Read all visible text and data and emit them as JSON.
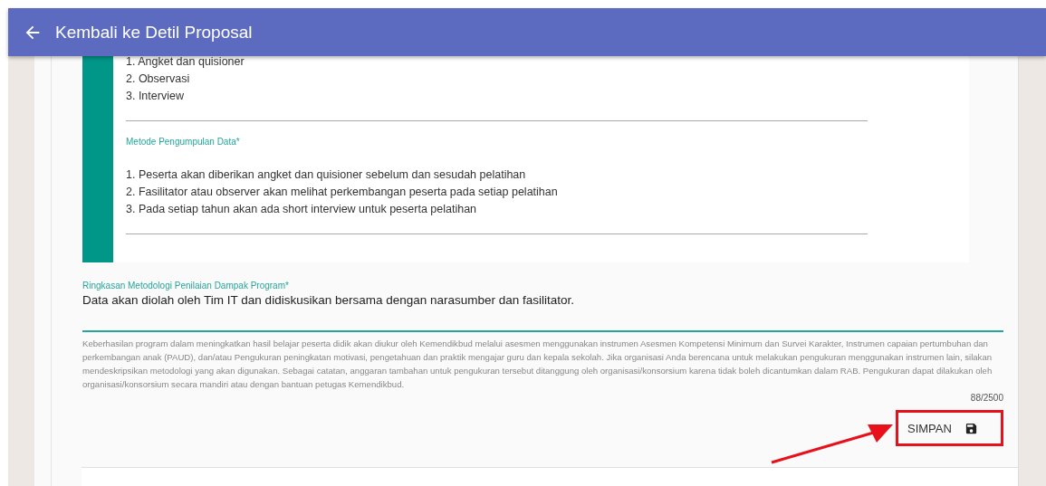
{
  "header": {
    "title": "Kembali ke Detil Proposal"
  },
  "previous_field": {
    "items": [
      "1. Angket dan quisioner",
      "2. Observasi",
      "3. Interview"
    ]
  },
  "data_collection": {
    "label": "Metode Pengumpulan Data*",
    "items": [
      "1. Peserta akan diberikan angket dan quisioner sebelum dan sesudah pelatihan",
      "2. Fasilitator atau observer akan melihat perkembangan peserta pada setiap pelatihan",
      "3. Pada setiap tahun akan ada short interview untuk peserta pelatihan"
    ]
  },
  "summary_field": {
    "label": "Ringkasan Metodologi Penilaian Dampak Program*",
    "value": "Data akan diolah oleh Tim IT dan didiskusikan bersama dengan narasumber dan fasilitator.",
    "help": "Keberhasilan program dalam meningkatkan hasil belajar peserta didik akan diukur oleh Kemendikbud melalui asesmen menggunakan instrumen Asesmen Kompetensi Minimum dan Survei Karakter, Instrumen capaian pertumbuhan dan perkembangan anak (PAUD), dan/atau Pengukuran peningkatan motivasi, pengetahuan dan praktik mengajar guru dan kepala sekolah. Jika organisasi Anda berencana untuk melakukan pengukuran menggunakan instrumen lain, silakan mendeskripsikan metodologi yang akan digunakan. Sebagai catatan, anggaran tambahan untuk pengukuran tersebut ditanggung oleh organisasi/konsorsium karena tidak boleh dicantumkan dalam RAB. Pengukuran dapat dilakukan oleh organisasi/konsorsium secara mandiri atau dengan bantuan petugas Kemendikbud.",
    "counter": "88/2500"
  },
  "save_button": {
    "label": "SIMPAN"
  }
}
